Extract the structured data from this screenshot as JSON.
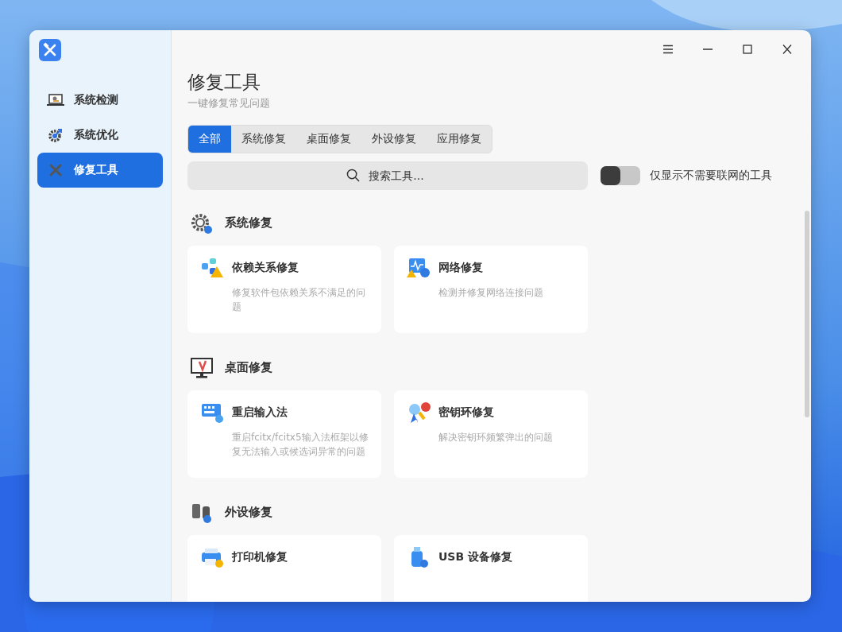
{
  "sidebar": {
    "items": [
      {
        "label": "系统检测",
        "selected": false
      },
      {
        "label": "系统优化",
        "selected": false
      },
      {
        "label": "修复工具",
        "selected": true
      }
    ]
  },
  "page": {
    "title": "修复工具",
    "subtitle": "一键修复常见问题"
  },
  "tabs": [
    {
      "label": "全部",
      "selected": true
    },
    {
      "label": "系统修复",
      "selected": false
    },
    {
      "label": "桌面修复",
      "selected": false
    },
    {
      "label": "外设修复",
      "selected": false
    },
    {
      "label": "应用修复",
      "selected": false
    }
  ],
  "search": {
    "placeholder": "搜索工具..."
  },
  "filter_toggle": {
    "label": "仅显示不需要联网的工具",
    "on": false
  },
  "sections": [
    {
      "title": "系统修复",
      "cards": [
        {
          "title": "依赖关系修复",
          "description": "修复软件包依赖关系不满足的问题"
        },
        {
          "title": "网络修复",
          "description": "检测并修复网络连接问题"
        }
      ]
    },
    {
      "title": "桌面修复",
      "cards": [
        {
          "title": "重启输入法",
          "description": "重启fcitx/fcitx5输入法框架以修复无法输入或候选词异常的问题"
        },
        {
          "title": "密钥环修复",
          "description": "解决密钥环频繁弹出的问题"
        }
      ]
    },
    {
      "title": "外设修复",
      "cards": [
        {
          "title": "打印机修复"
        },
        {
          "title": "USB 设备修复"
        }
      ]
    }
  ]
}
